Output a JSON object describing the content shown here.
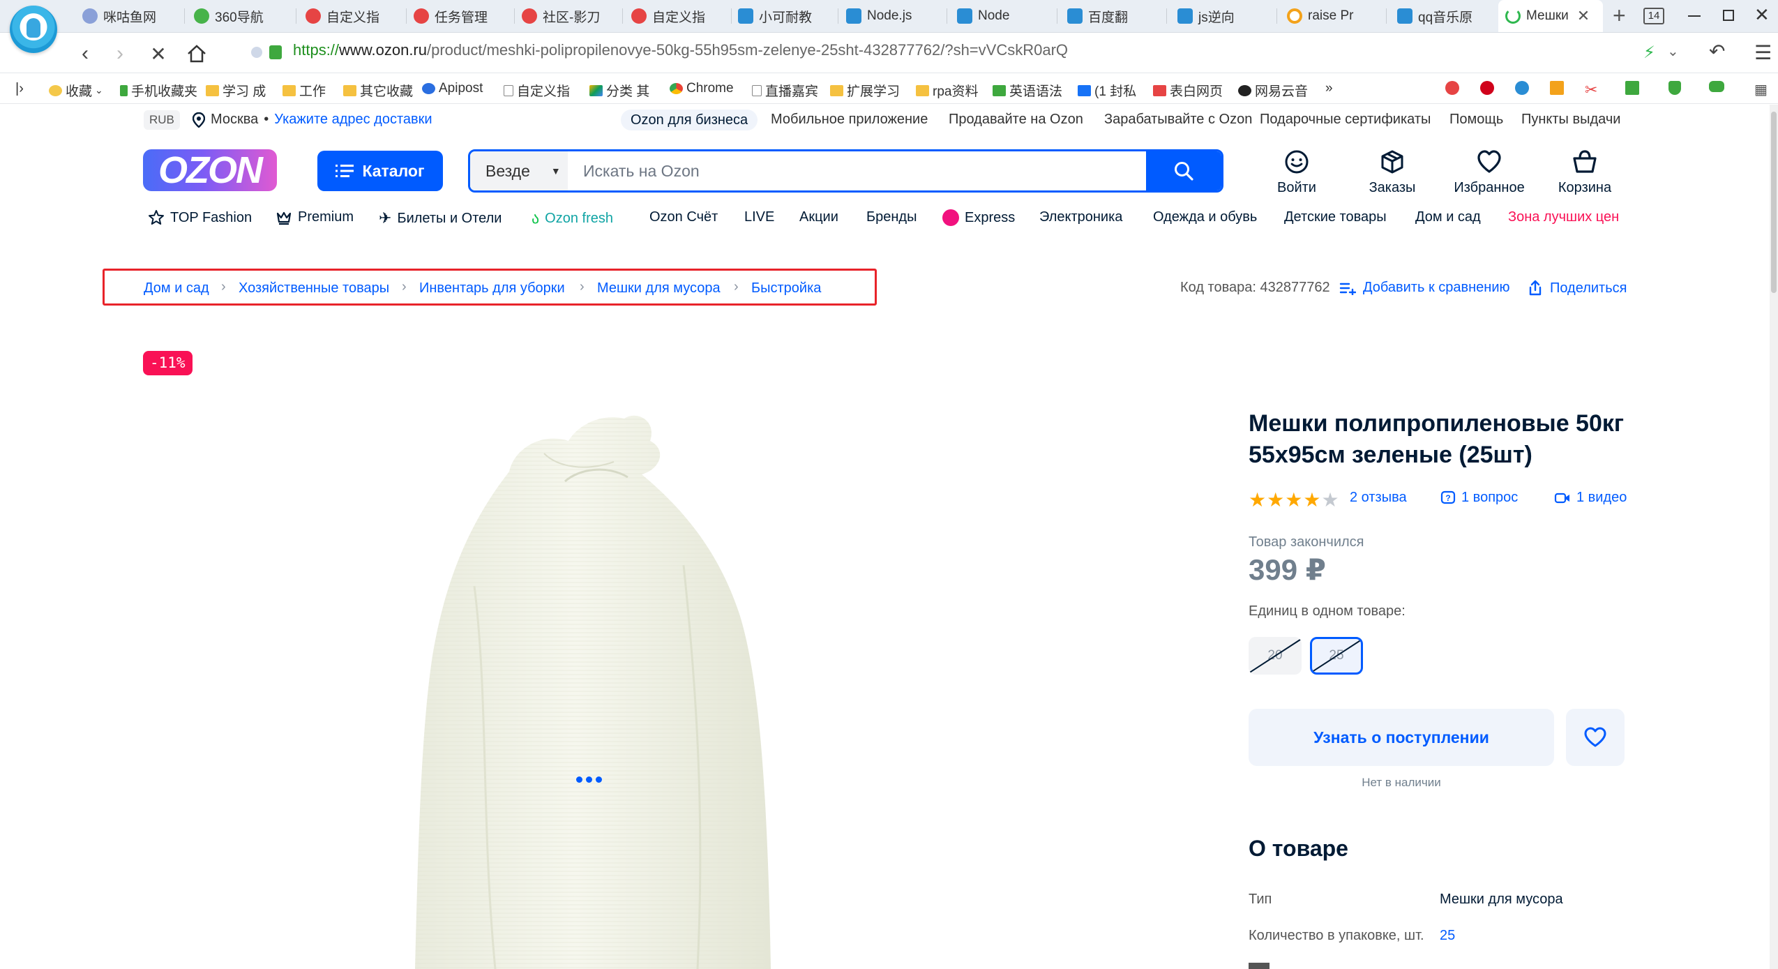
{
  "browser": {
    "tabs": [
      {
        "label": "咪咕鱼网",
        "color": "#8aa0d8"
      },
      {
        "label": "360导航",
        "color": "#47b34a"
      },
      {
        "label": "自定义指",
        "color": "#e64444"
      },
      {
        "label": "任务管理",
        "color": "#e64444"
      },
      {
        "label": "社区-影刀",
        "color": "#e64444"
      },
      {
        "label": "自定义指",
        "color": "#e64444"
      },
      {
        "label": "小可耐教",
        "color": "#2a8dd4"
      },
      {
        "label": "Node.js",
        "color": "#2a8dd4"
      },
      {
        "label": "Node",
        "color": "#2a8dd4"
      },
      {
        "label": "百度翻",
        "color": "#2a8dd4"
      },
      {
        "label": "js逆向",
        "color": "#2a8dd4"
      },
      {
        "label": "raise Pr",
        "color": "#f3a21b"
      },
      {
        "label": "qq音乐原",
        "color": "#2a8dd4"
      },
      {
        "label": "Мешки",
        "color": "#2fb84f"
      }
    ],
    "tab_count": "14",
    "url_scheme": "https://",
    "url_host": "www.ozon.ru",
    "url_rest": "/product/meshki-polipropilenovye-50kg-55h95sm-zelenye-25sht-432877762/?sh=vVCskR0arQ",
    "bookmarks": [
      {
        "label": "收藏",
        "kind": "star"
      },
      {
        "label": "手机收藏夹",
        "kind": "phone"
      },
      {
        "label": "学习 成",
        "kind": "folder"
      },
      {
        "label": "工作",
        "kind": "folder"
      },
      {
        "label": "其它收藏",
        "kind": "folder"
      },
      {
        "label": "Apipost",
        "kind": "app"
      },
      {
        "label": "自定义指",
        "kind": "page"
      },
      {
        "label": "分类 其",
        "kind": "drive"
      },
      {
        "label": "Chrome",
        "kind": "chrome"
      },
      {
        "label": "直播嘉宾",
        "kind": "page"
      },
      {
        "label": "扩展学习",
        "kind": "folder"
      },
      {
        "label": "rpa资料",
        "kind": "folder"
      },
      {
        "label": "英语语法",
        "kind": "green"
      },
      {
        "label": "(1 封私",
        "kind": "zhi"
      },
      {
        "label": "表白网页",
        "kind": "red"
      },
      {
        "label": "网易云音",
        "kind": "github"
      }
    ],
    "more": "»"
  },
  "site": {
    "currency": "RUB",
    "city": "Москва",
    "address_link": "Укажите адрес доставки",
    "top_links": [
      "Ozon для бизнеса",
      "Мобильное приложение",
      "Продавайте на Ozon",
      "Зарабатывайте с Ozon",
      "Подарочные сертификаты",
      "Помощь",
      "Пункты выдачи"
    ],
    "logo": "OZON",
    "catalog": "Каталог",
    "search_scope": "Везде",
    "search_placeholder": "Искать на Ozon",
    "header_icons": [
      "Войти",
      "Заказы",
      "Избранное",
      "Корзина"
    ],
    "menu": [
      "TOP Fashion",
      "Premium",
      "Билеты и Отели",
      "Ozon fresh",
      "Ozon Счёт",
      "LIVE",
      "Акции",
      "Бренды",
      "Express",
      "Электроника",
      "Одежда и обувь",
      "Детские товары",
      "Дом и сад",
      "Зона лучших цен"
    ]
  },
  "product": {
    "breadcrumbs": [
      "Дом и сад",
      "Хозяйственные товары",
      "Инвентарь для уборки",
      "Мешки для мусора",
      "Быстройка"
    ],
    "sku_label": "Код товара: 432877762",
    "compare": "Добавить к сравнению",
    "share": "Поделиться",
    "discount": "-11%",
    "title": "Мешки полипропиленовые 50кг 55х95см зеленые (25шт)",
    "rating": 4,
    "reviews": "2 отзыва",
    "questions": "1 вопрос",
    "videos": "1 видео",
    "out_of_stock": "Товар закончился",
    "price": "399 ₽",
    "units_label": "Единиц в одном товаре:",
    "units": [
      "20",
      "25"
    ],
    "notify": "Узнать о поступлении",
    "not_available": "Нет в наличии",
    "about_title": "О товаре",
    "specs": [
      {
        "k": "Тип",
        "v": "Мешки для мусора"
      },
      {
        "k": "Количество в упаковке, шт.",
        "v": "25"
      }
    ]
  },
  "colors": {
    "brand": "#005bff",
    "discount": "#f91155",
    "highlight": "#e8232a",
    "accent_red": "#f1117e",
    "fresh": "#10c44c"
  }
}
